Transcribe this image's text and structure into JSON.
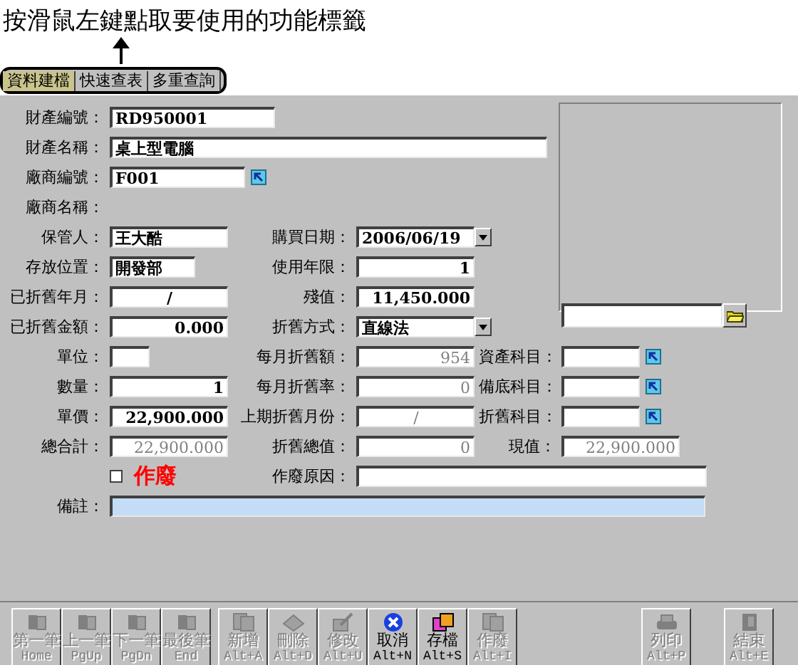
{
  "instruction": "按滑鼠左鍵點取要使用的功能標籤",
  "tabs": [
    {
      "label": "資料建檔",
      "selected": true
    },
    {
      "label": "快速查表",
      "selected": false
    },
    {
      "label": "多重查詢",
      "selected": false
    }
  ],
  "form": {
    "asset_no": {
      "label": "財產編號：",
      "value": "RD950001",
      "disabled": false
    },
    "asset_name": {
      "label": "財產名稱：",
      "value": "桌上型電腦",
      "disabled": false
    },
    "vendor_no": {
      "label": "廠商編號：",
      "value": "F001",
      "disabled": false
    },
    "vendor_name": {
      "label": "廠商名稱："
    },
    "custodian": {
      "label": "保管人：",
      "value": "王大酷",
      "disabled": false
    },
    "purchase_date": {
      "label": "購買日期：",
      "value": "2006/06/19",
      "disabled": false
    },
    "location": {
      "label": "存放位置：",
      "value": "開發部",
      "disabled": false
    },
    "useful_life": {
      "label": "使用年限：",
      "value": "1",
      "disabled": false
    },
    "depreciated_month": {
      "label": "已折舊年月：",
      "value": "/",
      "disabled": false
    },
    "salvage": {
      "label": "殘值：",
      "value": "11,450.000",
      "disabled": false
    },
    "depreciated_amount": {
      "label": "已折舊金額：",
      "value": "0.000",
      "disabled": false
    },
    "method": {
      "label": "折舊方式：",
      "value": "直線法",
      "disabled": false
    },
    "unit": {
      "label": "單位："
    },
    "monthly_dep": {
      "label": "每月折舊額：",
      "value": "954",
      "disabled": true
    },
    "asset_account": {
      "label": "資產科目："
    },
    "quantity": {
      "label": "數量：",
      "value": "1",
      "disabled": false
    },
    "monthly_rate": {
      "label": "每月折舊率：",
      "value": "0",
      "disabled": true
    },
    "allowance_account": {
      "label": "備底科目："
    },
    "unit_price": {
      "label": "單價：",
      "value": "22,900.000",
      "disabled": false
    },
    "last_period": {
      "label": "上期折舊月份：",
      "value": "/",
      "disabled": true
    },
    "dep_account": {
      "label": "折舊科目："
    },
    "total": {
      "label": "總合計：",
      "value": "22,900.000",
      "disabled": true
    },
    "dep_total": {
      "label": "折舊總值：",
      "value": "0",
      "disabled": true
    },
    "current_value": {
      "label": "現值：",
      "value": "22,900.000",
      "disabled": true
    },
    "scrap_reason": {
      "label": "作廢原因："
    },
    "remarks": {
      "label": "備註：",
      "focused": true
    }
  },
  "scrapped": {
    "label": "作廢",
    "checked": false
  },
  "toolbar": [
    {
      "buttons": [
        {
          "label": "第一筆",
          "key": "Home",
          "disabled": true
        },
        {
          "label": "上一筆",
          "key": "PgUp",
          "disabled": true
        },
        {
          "label": "下一筆",
          "key": "PgDn",
          "disabled": true
        },
        {
          "label": "最後筆",
          "key": "End",
          "disabled": true
        }
      ]
    },
    {
      "buttons": [
        {
          "label": "新增",
          "key": "Alt+A",
          "disabled": true
        },
        {
          "label": "刪除",
          "key": "Alt+D",
          "disabled": true
        },
        {
          "label": "修改",
          "key": "Alt+U",
          "disabled": true
        },
        {
          "label": "取消",
          "key": "Alt+N",
          "disabled": false
        },
        {
          "label": "存檔",
          "key": "Alt+S",
          "disabled": false
        },
        {
          "label": "作廢",
          "key": "Alt+I",
          "disabled": true
        }
      ]
    },
    {
      "buttons": [
        {
          "label": "列印",
          "key": "Alt+P",
          "disabled": true
        }
      ]
    },
    {
      "buttons": [
        {
          "label": "結束",
          "key": "Alt+E",
          "disabled": true
        }
      ]
    }
  ]
}
